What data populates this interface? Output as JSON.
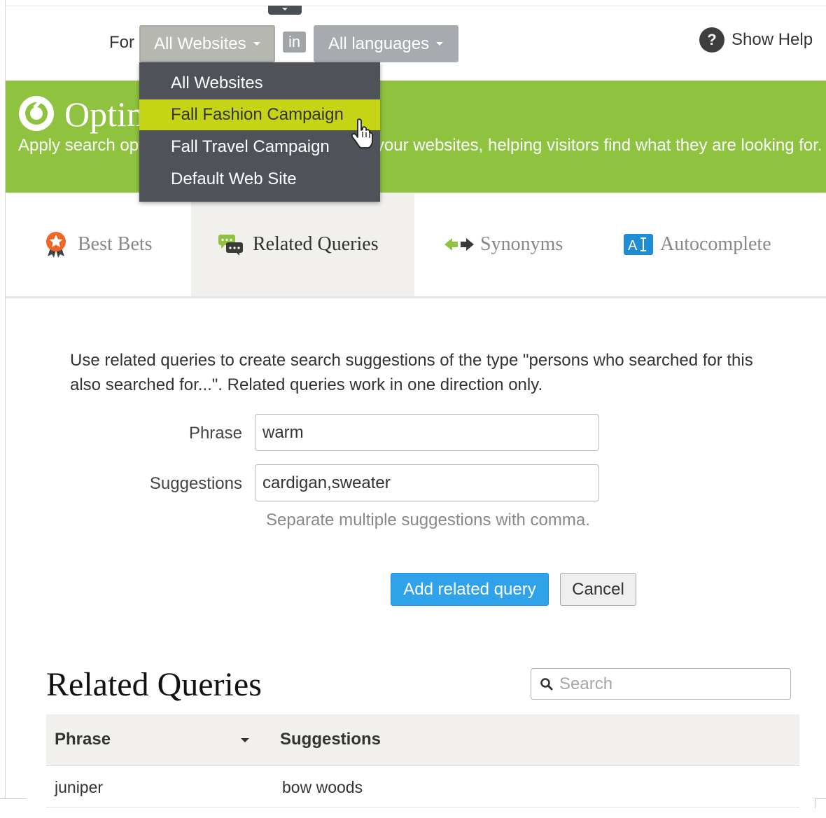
{
  "toolbar": {
    "for_label": "For",
    "website_select": "All Websites",
    "in_label": "in",
    "language_select": "All languages",
    "help_icon": "question-icon",
    "help_label": "Show Help"
  },
  "website_menu": {
    "items": [
      {
        "label": "All Websites"
      },
      {
        "label": "Fall Fashion Campaign",
        "hovered": true
      },
      {
        "label": "Fall Travel Campaign"
      },
      {
        "label": "Default Web Site"
      }
    ],
    "highlight_color": "#c5d515"
  },
  "banner": {
    "title": "Optimize Search",
    "description": "Apply search optimization to improve search on your websites, helping visitors find what they are looking for.",
    "color": "#8ec23f"
  },
  "tabs": [
    {
      "label": "Best Bets",
      "icon": "badge-star-icon",
      "active": false
    },
    {
      "label": "Related Queries",
      "icon": "chat-bubbles-icon",
      "active": true
    },
    {
      "label": "Synonyms",
      "icon": "arrows-left-right-icon",
      "active": false
    },
    {
      "label": "Autocomplete",
      "icon": "text-cursor-icon",
      "active": false
    }
  ],
  "form": {
    "intro": "Use related queries to create search suggestions of the type \"persons who searched for this also searched for...\". Related queries work in one direction only.",
    "phrase_label": "Phrase",
    "phrase_value": "warm",
    "suggestions_label": "Suggestions",
    "suggestions_value": "cardigan,sweater",
    "hint": "Separate multiple suggestions with comma.",
    "add_button": "Add related query",
    "cancel_button": "Cancel"
  },
  "list": {
    "title": "Related Queries",
    "search_placeholder": "Search",
    "columns": [
      "Phrase",
      "Suggestions"
    ],
    "rows": [
      {
        "phrase": "juniper",
        "suggestions": "bow woods"
      }
    ]
  }
}
